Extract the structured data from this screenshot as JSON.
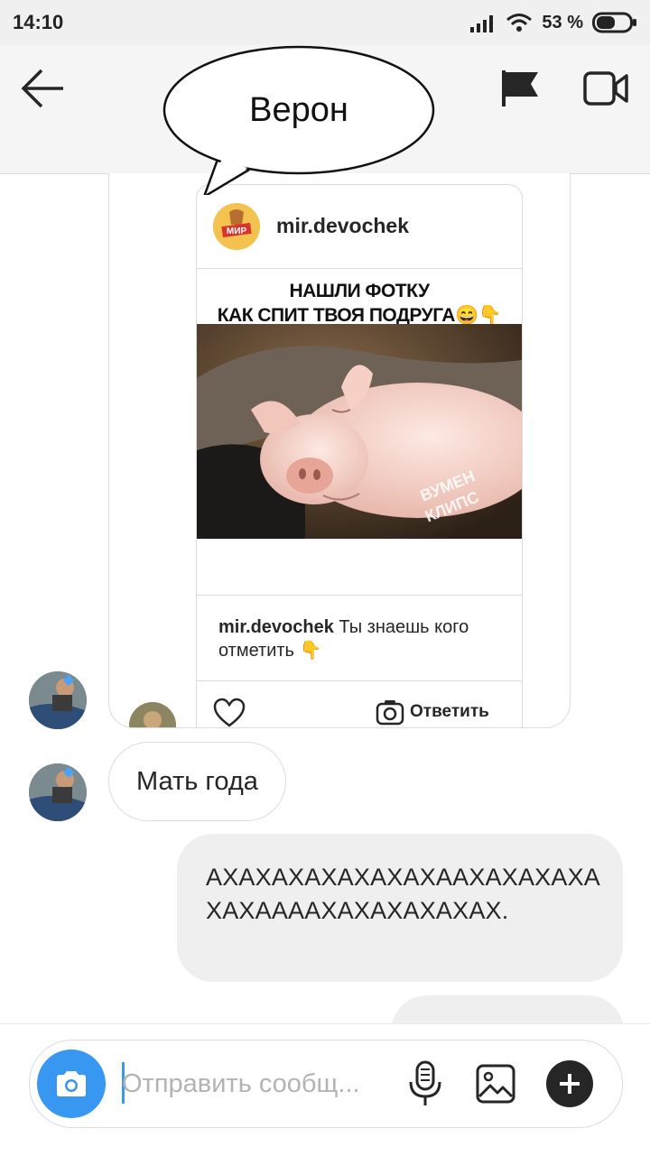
{
  "status_bar": {
    "time": "14:10",
    "battery_percent": "53 %",
    "signal_icon": "signal-icon",
    "wifi_icon": "wifi-icon",
    "battery_icon": "battery-icon"
  },
  "header": {
    "back_icon": "arrow-left-icon",
    "title": "Верон",
    "flag_icon": "flag-icon",
    "video_icon": "video-camera-icon"
  },
  "shared_post": {
    "username": "mir.devochek",
    "logo_text": "МИР",
    "headline_line1": "НАШЛИ ФОТКУ",
    "headline_line2": "КАК СПИТ ТВОЯ ПОДРУГА😄👇",
    "watermark_line1": "ВУМЕН",
    "watermark_line2": "КЛИПС",
    "caption_user": "mir.devochek",
    "caption_text": " Ты знаешь кого отметить 👇",
    "reply_label": "Ответить"
  },
  "messages": [
    {
      "side": "left",
      "text": "Мать года"
    },
    {
      "side": "right",
      "text": "АХАХАХАХАХАХАХААХАХАХАХАХАХААААХАХАХАХАХАХ."
    }
  ],
  "composer": {
    "placeholder": "Отправить сообщ..."
  },
  "colors": {
    "accent": "#3897f0",
    "bubble_bg": "#efefef",
    "border": "#dbdbdb"
  }
}
